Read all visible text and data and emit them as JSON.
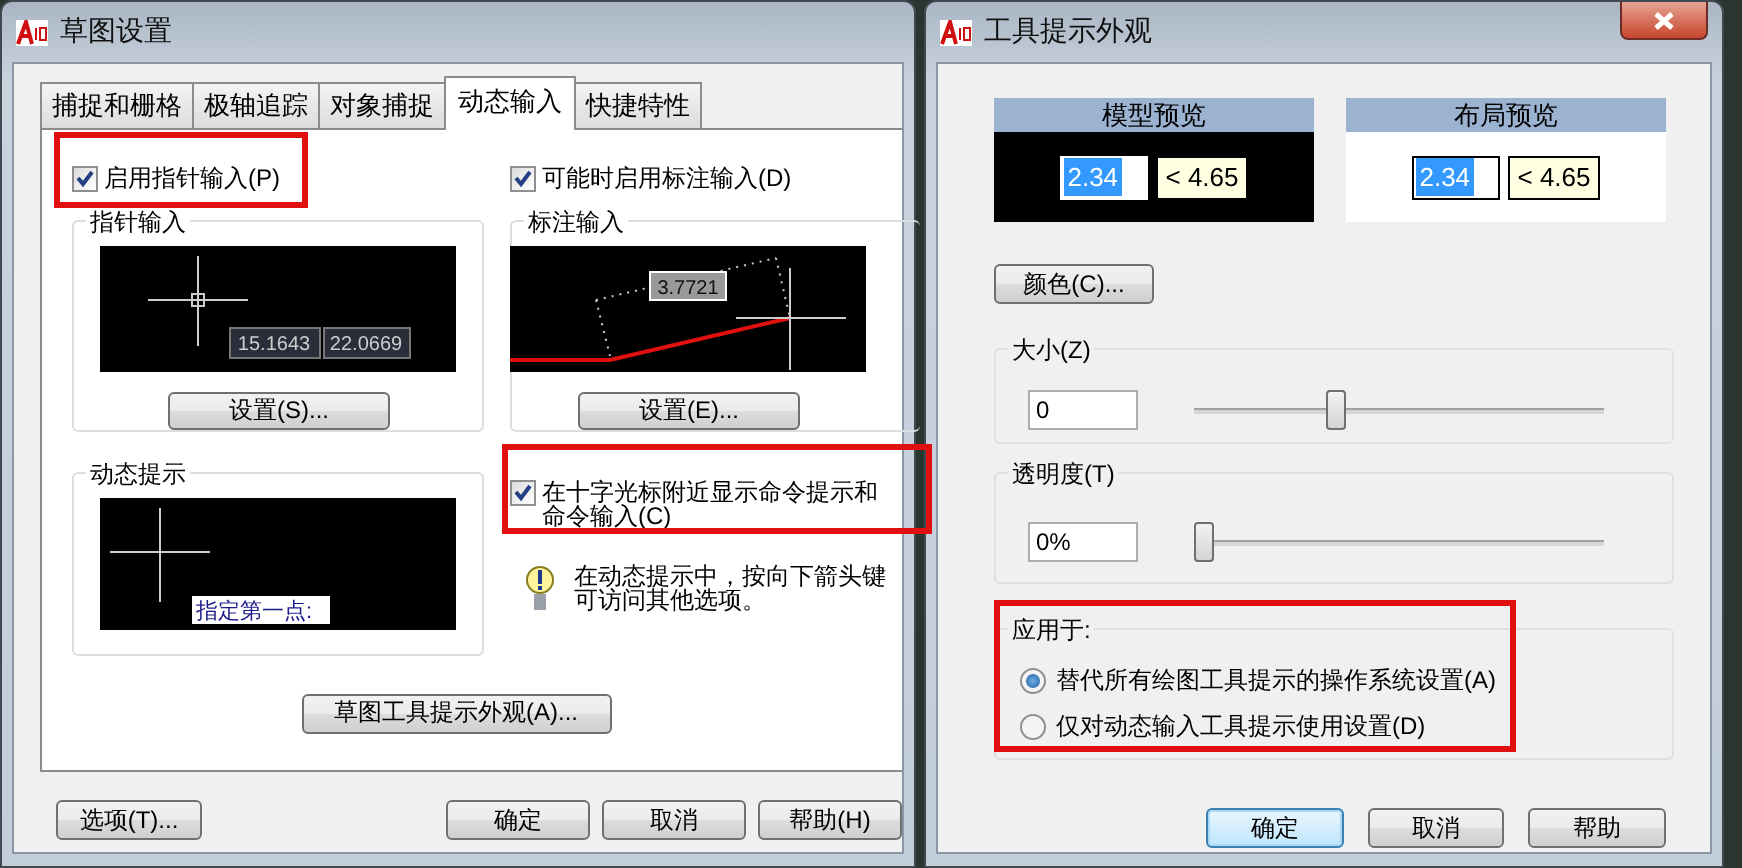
{
  "drafting_settings": {
    "title": "草图设置",
    "tabs": [
      {
        "label": "捕捉和栅格",
        "selected": false
      },
      {
        "label": "极轴追踪",
        "selected": false
      },
      {
        "label": "对象捕捉",
        "selected": false
      },
      {
        "label": "动态输入",
        "selected": true
      },
      {
        "label": "快捷特性",
        "selected": false
      }
    ],
    "pointer_input": {
      "checkbox": {
        "label": "启用指针输入(P)",
        "checked": true
      },
      "group_title": "指针输入",
      "preview_values": [
        "15.1643",
        "22.0669"
      ],
      "settings_button": "设置(S)..."
    },
    "dimension_input": {
      "checkbox": {
        "label": "可能时启用标注输入(D)",
        "checked": true
      },
      "group_title": "标注输入",
      "preview_value": "3.7721",
      "settings_button": "设置(E)..."
    },
    "dynamic_prompt": {
      "group_title": "动态提示",
      "preview_prompt": "指定第一点:"
    },
    "crosshair_checkbox": {
      "label": "在十字光标附近显示命令提示和命令输入(C)",
      "checked": true
    },
    "tip": "在动态提示中，按向下箭头键可访问其他选项。",
    "appearance_button": "草图工具提示外观(A)...",
    "options_button": "选项(T)...",
    "buttons": [
      "确定",
      "取消",
      "帮助(H)"
    ]
  },
  "tooltip_appearance": {
    "title": "工具提示外观",
    "previews": [
      {
        "title": "模型预览",
        "kind": "dark",
        "value": "2.34",
        "angle": "< 4.65"
      },
      {
        "title": "布局预览",
        "kind": "light",
        "value": "2.34",
        "angle": "< 4.65"
      }
    ],
    "color_button": "颜色(C)...",
    "sliders": [
      {
        "label": "大小(Z)",
        "value": "0",
        "level": 0.34
      },
      {
        "label": "透明度(T)",
        "value": "0%",
        "level": 0
      }
    ],
    "apply_to": {
      "label": "应用于:",
      "options": [
        {
          "label": "替代所有绘图工具提示的操作系统设置(A)",
          "selected": true
        },
        {
          "label": "仅对动态输入工具提示使用设置(D)",
          "selected": false
        }
      ]
    },
    "buttons": [
      {
        "label": "确定",
        "default": true
      },
      {
        "label": "取消",
        "default": false
      },
      {
        "label": "帮助",
        "default": false
      }
    ]
  }
}
